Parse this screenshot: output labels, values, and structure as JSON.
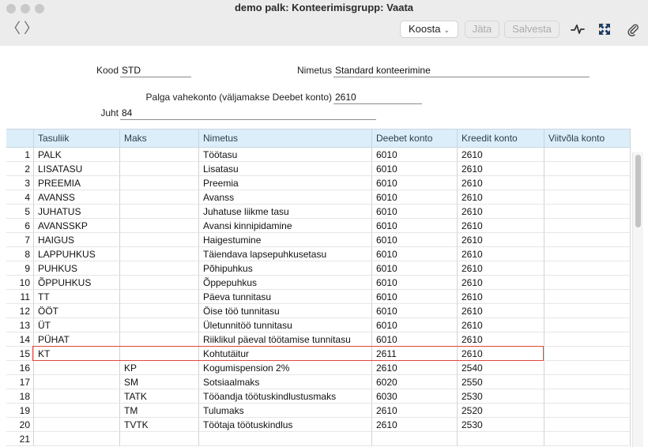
{
  "window": {
    "title": "demo palk: Konteerimisgrupp: Vaata"
  },
  "toolbar": {
    "back": "〈",
    "forward": "〉",
    "koosta_label": "Koosta",
    "koosta_chevron": "⌄",
    "jata_label": "Jäta",
    "salvesta_label": "Salvesta",
    "icons": [
      "activity-icon",
      "expand-icon",
      "paperclip-icon"
    ]
  },
  "form": {
    "kood_label": "Kood",
    "kood_value": "STD",
    "nimetus_label": "Nimetus",
    "nimetus_value": "Standard konteerimine",
    "palga_label": "Palga vahekonto (väljamakse Deebet konto)",
    "palga_value": "2610",
    "juht_label": "Juht",
    "juht_value": "84"
  },
  "table": {
    "columns": [
      "",
      "Tasuliik",
      "Maks",
      "Nimetus",
      "Deebet konto",
      "Kreedit konto",
      "Viitvõla konto"
    ],
    "rows": [
      [
        "1",
        "PALK",
        "",
        "Töötasu",
        "6010",
        "2610",
        ""
      ],
      [
        "2",
        "LISATASU",
        "",
        "Lisatasu",
        "6010",
        "2610",
        ""
      ],
      [
        "3",
        "PREEMIA",
        "",
        "Preemia",
        "6010",
        "2610",
        ""
      ],
      [
        "4",
        "AVANSS",
        "",
        "Avanss",
        "6010",
        "2610",
        ""
      ],
      [
        "5",
        "JUHATUS",
        "",
        "Juhatuse liikme tasu",
        "6010",
        "2610",
        ""
      ],
      [
        "6",
        "AVANSSKP",
        "",
        "Avansi kinnipidamine",
        "6010",
        "2610",
        ""
      ],
      [
        "7",
        "HAIGUS",
        "",
        "Haigestumine",
        "6010",
        "2610",
        ""
      ],
      [
        "8",
        "LAPPUHKUS",
        "",
        "Täiendava lapsepuhkusetasu",
        "6010",
        "2610",
        ""
      ],
      [
        "9",
        "PUHKUS",
        "",
        "Põhipuhkus",
        "6010",
        "2610",
        ""
      ],
      [
        "10",
        "ÕPPUHKUS",
        "",
        "Õppepuhkus",
        "6010",
        "2610",
        ""
      ],
      [
        "11",
        "TT",
        "",
        "Päeva tunnitasu",
        "6010",
        "2610",
        ""
      ],
      [
        "12",
        "ÖÖT",
        "",
        "Öise töö tunnitasu",
        "6010",
        "2610",
        ""
      ],
      [
        "13",
        "ÜT",
        "",
        "Ületunnitöö tunnitasu",
        "6010",
        "2610",
        ""
      ],
      [
        "14",
        "PÜHAT",
        "",
        "Riiklikul päeval töötamise tunnitasu",
        "6010",
        "2610",
        ""
      ],
      [
        "15",
        "KT",
        "",
        "Kohtutäitur",
        "2611",
        "2610",
        ""
      ],
      [
        "16",
        "",
        "KP",
        "Kogumispension 2%",
        "2610",
        "2540",
        ""
      ],
      [
        "17",
        "",
        "SM",
        "Sotsiaalmaks",
        "6020",
        "2550",
        ""
      ],
      [
        "18",
        "",
        "TATK",
        "Tööandja töötuskindlustusmaks",
        "6030",
        "2530",
        ""
      ],
      [
        "19",
        "",
        "TM",
        "Tulumaks",
        "2610",
        "2520",
        ""
      ],
      [
        "20",
        "",
        "TVTK",
        "Töötaja töötuskindlus",
        "2610",
        "2530",
        ""
      ],
      [
        "21",
        "",
        "",
        "",
        "",
        "",
        ""
      ]
    ],
    "highlighted_row": "15"
  },
  "colors": {
    "header_bg": "#dbeef9",
    "highlight_border": "#e0493c",
    "toolbar_bg": "#ececec"
  }
}
